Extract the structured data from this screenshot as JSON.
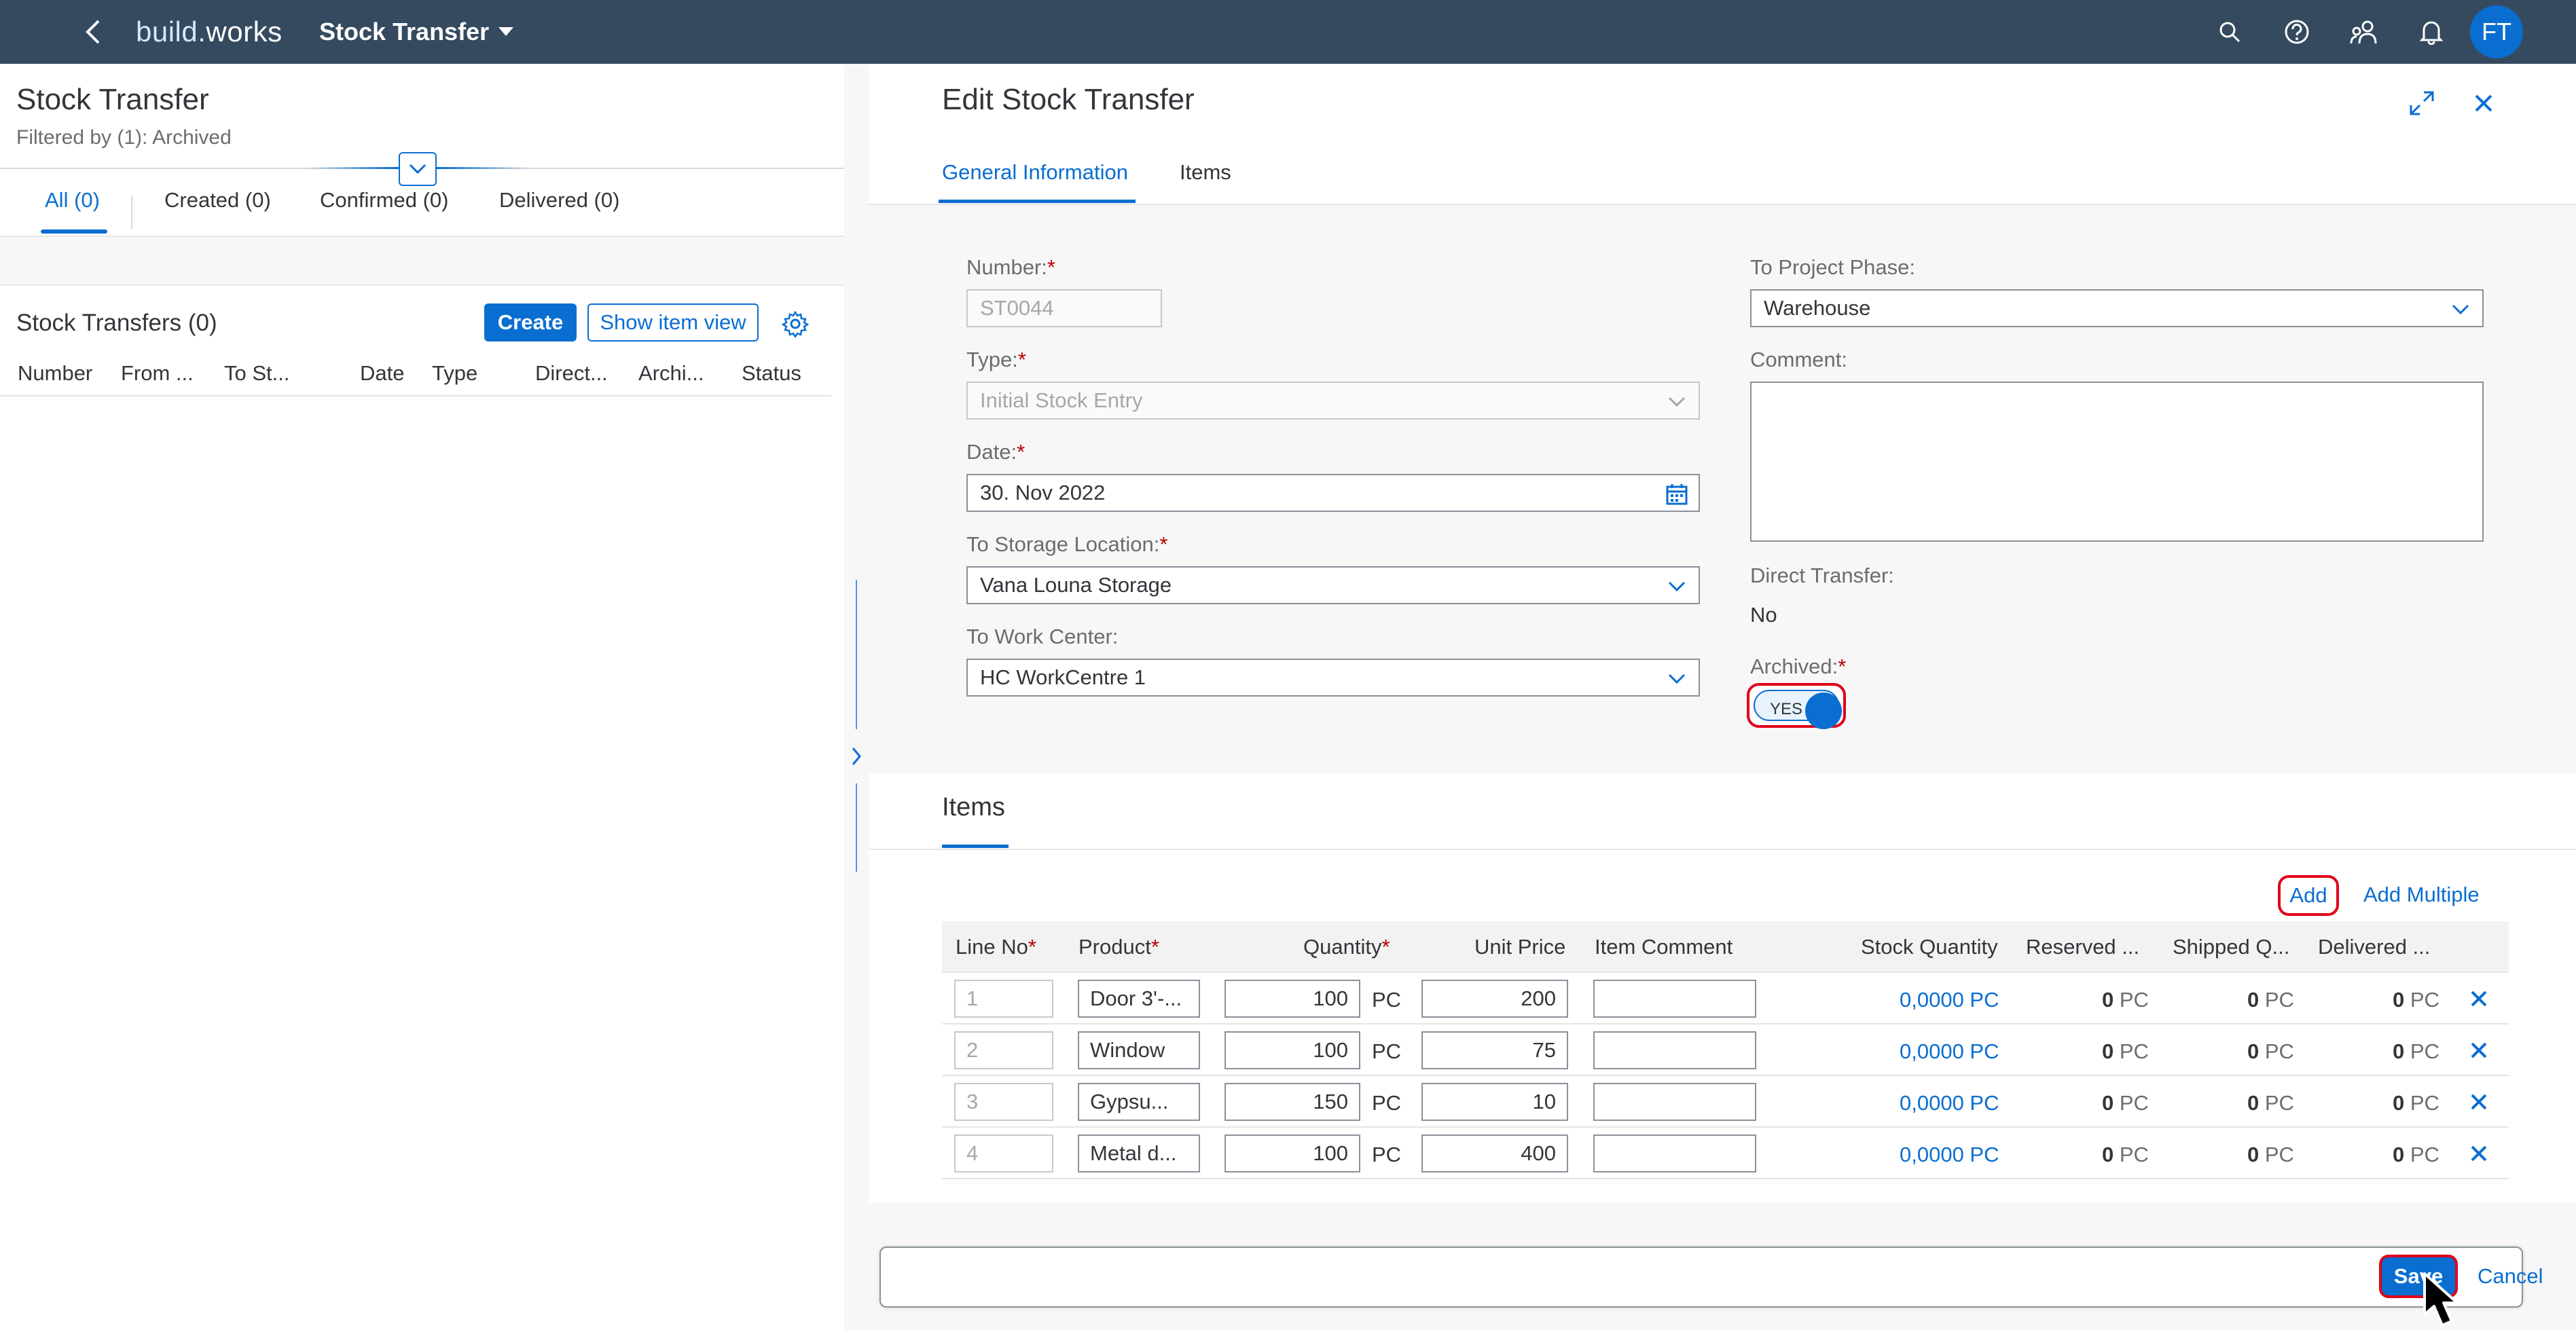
{
  "shell": {
    "logo_prefix": "build.",
    "logo_suffix": "works",
    "app_title": "Stock Transfer",
    "avatar_initials": "FT",
    "icons": [
      "back-icon",
      "search-icon",
      "help-icon",
      "people-icon",
      "bell-icon"
    ]
  },
  "list": {
    "title": "Stock Transfer",
    "filter_text": "Filtered by (1): Archived",
    "tabs": [
      {
        "label": "All (0)",
        "selected": true
      },
      {
        "label": "Created (0)"
      },
      {
        "label": "Confirmed (0)"
      },
      {
        "label": "Delivered (0)"
      }
    ],
    "table_title": "Stock Transfers (0)",
    "create_label": "Create",
    "show_item_view_label": "Show item view",
    "columns": [
      "Number",
      "From ...",
      "To St...",
      "Date",
      "Type",
      "Direct...",
      "Archi...",
      "Status"
    ]
  },
  "detail": {
    "title": "Edit Stock Transfer",
    "tabs": [
      {
        "label": "General Information",
        "selected": true
      },
      {
        "label": "Items"
      }
    ],
    "form": {
      "number_label": "Number:",
      "number_value": "ST0044",
      "type_label": "Type:",
      "type_value": "Initial Stock Entry",
      "date_label": "Date:",
      "date_value": "30. Nov 2022",
      "storage_label": "To Storage Location:",
      "storage_value": "Vana Louna Storage",
      "workcenter_label": "To Work Center:",
      "workcenter_value": "HC WorkCentre 1",
      "phase_label": "To Project Phase:",
      "phase_value": "Warehouse",
      "comment_label": "Comment:",
      "comment_value": "",
      "direct_label": "Direct Transfer:",
      "direct_value": "No",
      "archived_label": "Archived:",
      "archived_switch_text": "YES",
      "required_mark": "*"
    },
    "items": {
      "section_title": "Items",
      "add_label": "Add",
      "add_multiple_label": "Add Multiple",
      "columns": {
        "line": "Line No",
        "product": "Product",
        "quantity": "Quantity",
        "unit_price": "Unit Price",
        "comment": "Item Comment",
        "stock": "Stock Quantity",
        "reserved": "Reserved ...",
        "shipped": "Shipped Q...",
        "delivered": "Delivered ..."
      },
      "rows": [
        {
          "line": "1",
          "product": "Door 3'-...",
          "quantity": "100",
          "unit": "PC",
          "price": "200",
          "comment": "",
          "stock": "0,0000 PC",
          "reserved": "0",
          "shipped": "0",
          "delivered": "0",
          "qty_unit": "PC"
        },
        {
          "line": "2",
          "product": "Window",
          "quantity": "100",
          "unit": "PC",
          "price": "75",
          "comment": "",
          "stock": "0,0000 PC",
          "reserved": "0",
          "shipped": "0",
          "delivered": "0",
          "qty_unit": "PC"
        },
        {
          "line": "3",
          "product": "Gypsu...",
          "quantity": "150",
          "unit": "PC",
          "price": "10",
          "comment": "",
          "stock": "0,0000 PC",
          "reserved": "0",
          "shipped": "0",
          "delivered": "0",
          "qty_unit": "PC"
        },
        {
          "line": "4",
          "product": "Metal d...",
          "quantity": "100",
          "unit": "PC",
          "price": "400",
          "comment": "",
          "stock": "0,0000 PC",
          "reserved": "0",
          "shipped": "0",
          "delivered": "0",
          "qty_unit": "PC"
        }
      ]
    },
    "footer": {
      "save_label": "Save",
      "cancel_label": "Cancel"
    }
  },
  "colors": {
    "shell_bg": "#354a5f",
    "accent": "#0a6ed1",
    "highlight": "#e0001a",
    "required": "#bb0000"
  }
}
